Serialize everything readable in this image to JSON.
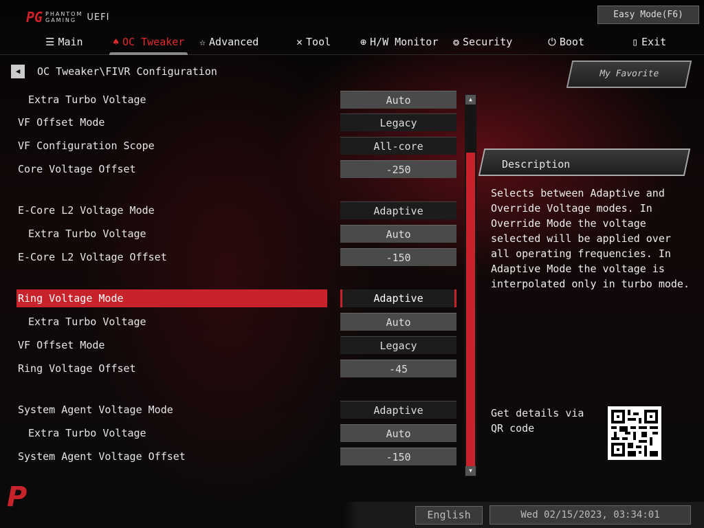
{
  "header": {
    "brand_line1": "PHANTOM",
    "brand_line2": "GAMING",
    "brand_uefi": "UEFI",
    "easy_mode": "Easy Mode(F6)"
  },
  "tabs": [
    {
      "label": "Main",
      "icon": "list-icon"
    },
    {
      "label": "OC Tweaker",
      "icon": "flame-icon",
      "active": true
    },
    {
      "label": "Advanced",
      "icon": "star-icon"
    },
    {
      "label": "Tool",
      "icon": "tools-icon"
    },
    {
      "label": "H/W Monitor",
      "icon": "globe-icon"
    },
    {
      "label": "Security",
      "icon": "shield-icon"
    },
    {
      "label": "Boot",
      "icon": "power-icon"
    },
    {
      "label": "Exit",
      "icon": "exit-icon"
    }
  ],
  "breadcrumb": "OC Tweaker\\FIVR Configuration",
  "my_favorite": "My Favorite",
  "settings": [
    {
      "label": "Extra Turbo Voltage",
      "value": "Auto"
    },
    {
      "label": "VF Offset Mode",
      "value": "Legacy"
    },
    {
      "label": "VF Configuration Scope",
      "value": "All-core"
    },
    {
      "label": "Core Voltage Offset",
      "value": "-250"
    },
    {
      "label": "E-Core L2 Voltage Mode",
      "value": "Adaptive"
    },
    {
      "label": "Extra Turbo Voltage",
      "value": "Auto"
    },
    {
      "label": "E-Core L2 Voltage Offset",
      "value": "-150"
    },
    {
      "label": "Ring Voltage Mode",
      "value": "Adaptive"
    },
    {
      "label": "Extra Turbo Voltage",
      "value": "Auto"
    },
    {
      "label": "VF Offset Mode",
      "value": "Legacy"
    },
    {
      "label": "Ring Voltage Offset",
      "value": "-45"
    },
    {
      "label": "System Agent Voltage Mode",
      "value": "Adaptive"
    },
    {
      "label": "Extra Turbo Voltage",
      "value": "Auto"
    },
    {
      "label": "System Agent Voltage Offset",
      "value": "-150"
    }
  ],
  "description": {
    "title": "Description",
    "text": "Selects between Adaptive and Override Voltage modes. In Override Mode the voltage selected will be applied over all operating frequencies. In Adaptive Mode the voltage is interpolated only in turbo mode."
  },
  "qr_text": "Get details via QR code",
  "footer": {
    "language": "English",
    "datetime": "Wed 02/15/2023, 03:34:01"
  },
  "colors": {
    "accent": "#c8232b"
  }
}
